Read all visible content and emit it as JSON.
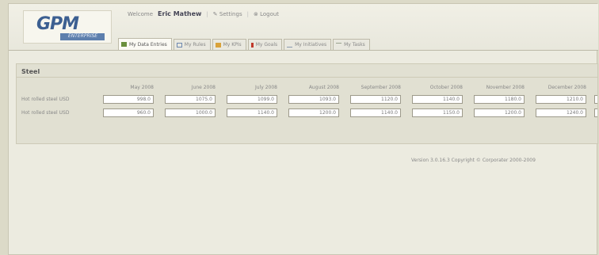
{
  "app": {
    "logo": "GPM",
    "logo_sub": "ENTERPRISE"
  },
  "topbar": {
    "welcome": "Welcome",
    "user": "Eric Mathew",
    "settings": "Settings",
    "logout": "Logout"
  },
  "tabs": [
    {
      "label": "My Data Entries",
      "icon": "data-entry-icon",
      "color": "#6a8f3d",
      "active": true
    },
    {
      "label": "My Rules",
      "icon": "rules-icon",
      "color": "#6d88b0",
      "active": false
    },
    {
      "label": "My KPIs",
      "icon": "kpi-icon",
      "color": "#d9a23a",
      "active": false
    },
    {
      "label": "My Goals",
      "icon": "goals-icon",
      "color": "#c0392b",
      "active": false
    },
    {
      "label": "My Initiatives",
      "icon": "initiatives-icon",
      "color": "#8a9ab0",
      "active": false
    },
    {
      "label": "My Tasks",
      "icon": "tasks-icon",
      "color": "#9aa38d",
      "active": false
    }
  ],
  "panel": {
    "title": "Steel",
    "months": [
      "May 2008",
      "June 2008",
      "July 2008",
      "August 2008",
      "September 2008",
      "October 2008",
      "November 2008",
      "December 2008"
    ],
    "rows": [
      {
        "label": "Hot rolled steel USD",
        "values": [
          "998.0",
          "1075.0",
          "1099.0",
          "1093.0",
          "1120.0",
          "1140.0",
          "1180.0",
          "1210.0"
        ]
      },
      {
        "label": "Hot rolled steel USD",
        "values": [
          "960.0",
          "1000.0",
          "1140.0",
          "1200.0",
          "1140.0",
          "1150.0",
          "1200.0",
          "1240.0"
        ]
      }
    ]
  },
  "footer": {
    "version": "Version 3.0.16.3 Copyright © Corporater 2000-2009"
  }
}
